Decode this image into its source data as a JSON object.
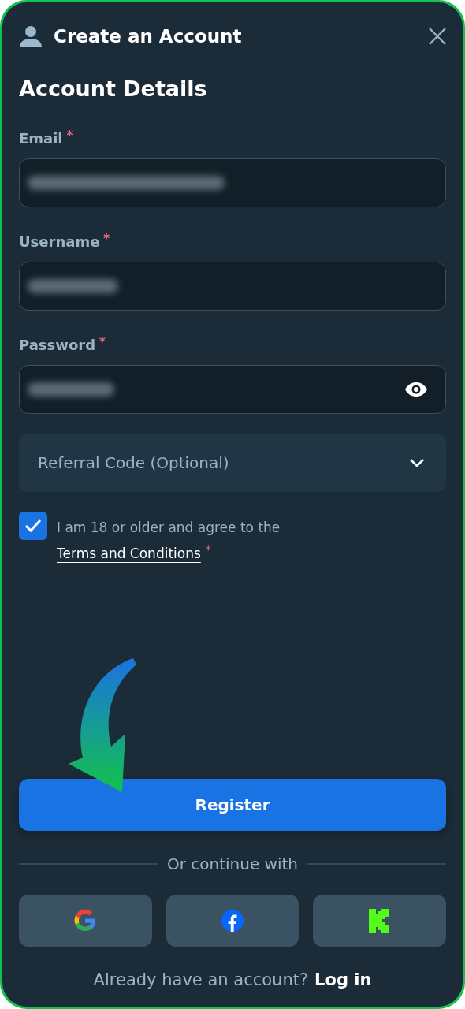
{
  "dialog": {
    "title": "Create an Account"
  },
  "section_title": "Account Details",
  "fields": [
    {
      "label": "Email",
      "required_mark": "*",
      "kind": "email"
    },
    {
      "label": "Username",
      "required_mark": "*",
      "kind": "text"
    },
    {
      "label": "Password",
      "required_mark": "*",
      "kind": "password"
    }
  ],
  "referral": {
    "label": "Referral Code (Optional)",
    "expanded": false
  },
  "agreement": {
    "checked": true,
    "text": "I am 18 or older and agree to the",
    "link": "Terms and Conditions",
    "required_mark": "*"
  },
  "register_button": "Register",
  "divider_text": "Or continue with",
  "social_buttons": [
    {
      "kind": "google"
    },
    {
      "kind": "facebook"
    },
    {
      "kind": "kick"
    }
  ],
  "footer": {
    "text": "Already have an account?",
    "link": "Log in"
  }
}
